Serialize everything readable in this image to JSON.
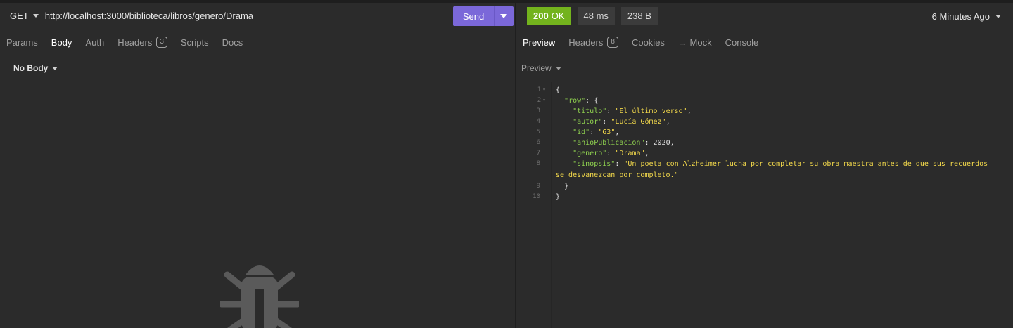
{
  "request": {
    "method": "GET",
    "url": "http://localhost:3000/biblioteca/libros/genero/Drama",
    "send_label": "Send"
  },
  "request_tabs": [
    {
      "label": "Params"
    },
    {
      "label": "Body"
    },
    {
      "label": "Auth"
    },
    {
      "label": "Headers",
      "count": "3"
    },
    {
      "label": "Scripts"
    },
    {
      "label": "Docs"
    }
  ],
  "body_selector": "No Body",
  "response": {
    "status_code": "200",
    "status_text": "OK",
    "time": "48 ms",
    "size": "238 B",
    "ago": "6 Minutes Ago"
  },
  "response_tabs": [
    {
      "label": "Preview"
    },
    {
      "label": "Headers",
      "count": "8"
    },
    {
      "label": "Cookies"
    },
    {
      "label": "→ Mock"
    },
    {
      "label": "Console"
    }
  ],
  "preview_selector": "Preview",
  "json_preview": {
    "line_numbers": [
      "1",
      "2",
      "3",
      "4",
      "5",
      "6",
      "7",
      "8",
      "9",
      "10"
    ],
    "root_key": "row",
    "fields": [
      {
        "key": "titulo",
        "value": "El último verso"
      },
      {
        "key": "autor",
        "value": "Lucía Gómez"
      },
      {
        "key": "id",
        "value": "63"
      },
      {
        "key": "anioPublicacion",
        "value": "2020"
      },
      {
        "key": "genero",
        "value": "Drama"
      },
      {
        "key": "sinopsis",
        "value_line1": "Un poeta con Alzheimer lucha por completar su obra maestra antes de que sus recuerdos",
        "value_line2": "se desvanezcan por completo."
      }
    ]
  },
  "colors": {
    "send_button": "#7b68d9",
    "status_ok": "#73b31d",
    "json_key": "#8fd14f",
    "json_string": "#f2d84b",
    "background": "#2b2b2b"
  },
  "icons": {
    "empty_state": "bug-icon"
  }
}
